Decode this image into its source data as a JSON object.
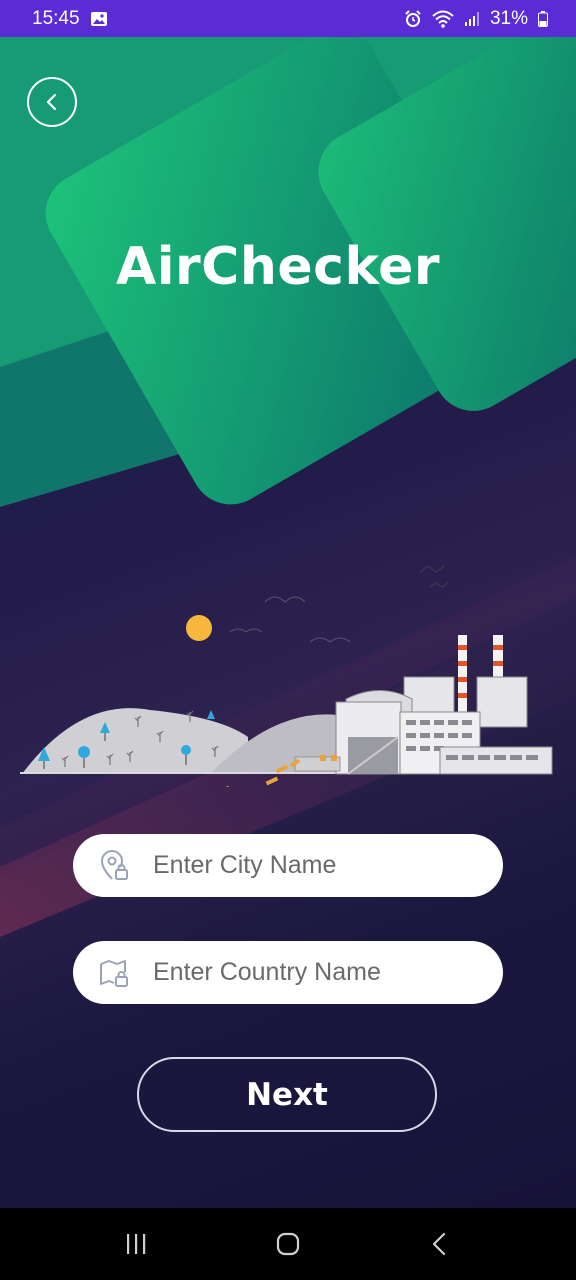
{
  "status_bar": {
    "time": "15:45",
    "battery": "31%",
    "icons": [
      "image-icon",
      "alarm-icon",
      "wifi-icon",
      "signal-icon",
      "battery-icon"
    ]
  },
  "app": {
    "title": "AirChecker",
    "back_icon": "chevron-left-icon",
    "city_input": {
      "placeholder": "Enter City Name",
      "value": "",
      "icon": "location-pin-icon"
    },
    "country_input": {
      "placeholder": "Enter Country Name",
      "value": "",
      "icon": "map-icon"
    },
    "next_label": "Next"
  },
  "colors": {
    "status_bar": "#5b2bd6",
    "green_start": "#1dc47a",
    "green_end": "#0c7c6e",
    "background": "#1e1a47",
    "sun": "#f6b73c"
  },
  "nav_bar": {
    "buttons": [
      "recent-apps-icon",
      "home-icon",
      "back-icon"
    ]
  }
}
